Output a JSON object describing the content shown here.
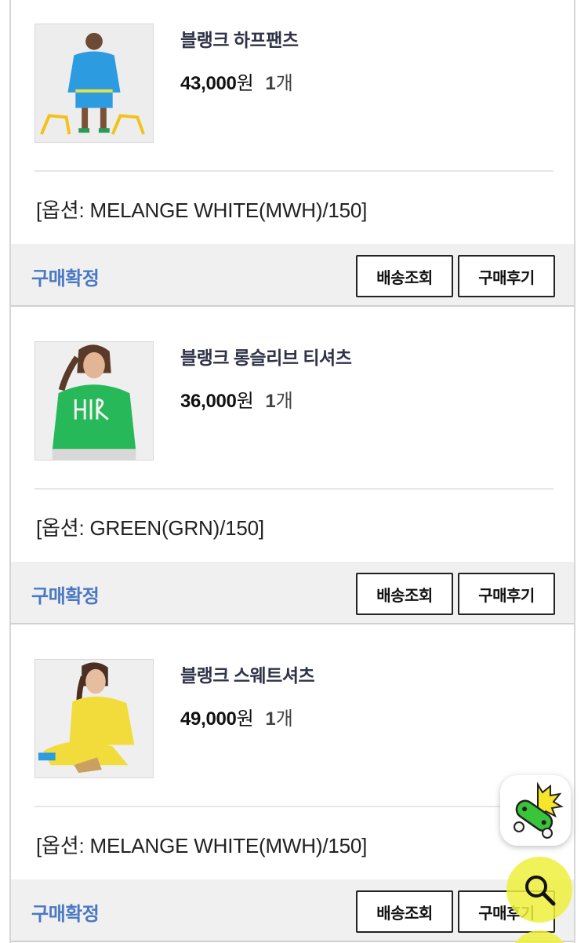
{
  "orders": [
    {
      "product_name": "블랭크 하프팬츠",
      "price_amount": "43,000",
      "price_unit": "원",
      "qty_num": "1",
      "qty_unit": "개",
      "option": "[옵션: MELANGE WHITE(MWH)/150]",
      "status": "구매확정",
      "track_label": "배송조회",
      "review_label": "구매후기",
      "thumb_color": "#2c9be0"
    },
    {
      "product_name": "블랭크 롱슬리브 티셔츠",
      "price_amount": "36,000",
      "price_unit": "원",
      "qty_num": "1",
      "qty_unit": "개",
      "option": "[옵션: GREEN(GRN)/150]",
      "status": "구매확정",
      "track_label": "배송조회",
      "review_label": "구매후기",
      "thumb_color": "#27b85a"
    },
    {
      "product_name": "블랭크 스웨트셔츠",
      "price_amount": "49,000",
      "price_unit": "원",
      "qty_num": "1",
      "qty_unit": "개",
      "option": "[옵션: MELANGE WHITE(MWH)/150]",
      "status": "구매확정",
      "track_label": "배송조회",
      "review_label": "구매후기",
      "thumb_color": "#f2dc3c"
    }
  ],
  "floating": {
    "app_icon": "skateboard-icon",
    "search_icon": "search-icon",
    "search_color": "#eef03c"
  },
  "colors": {
    "status": "#4a78c4",
    "title": "#2f3348",
    "action_bar_bg": "#f0f0f0"
  }
}
